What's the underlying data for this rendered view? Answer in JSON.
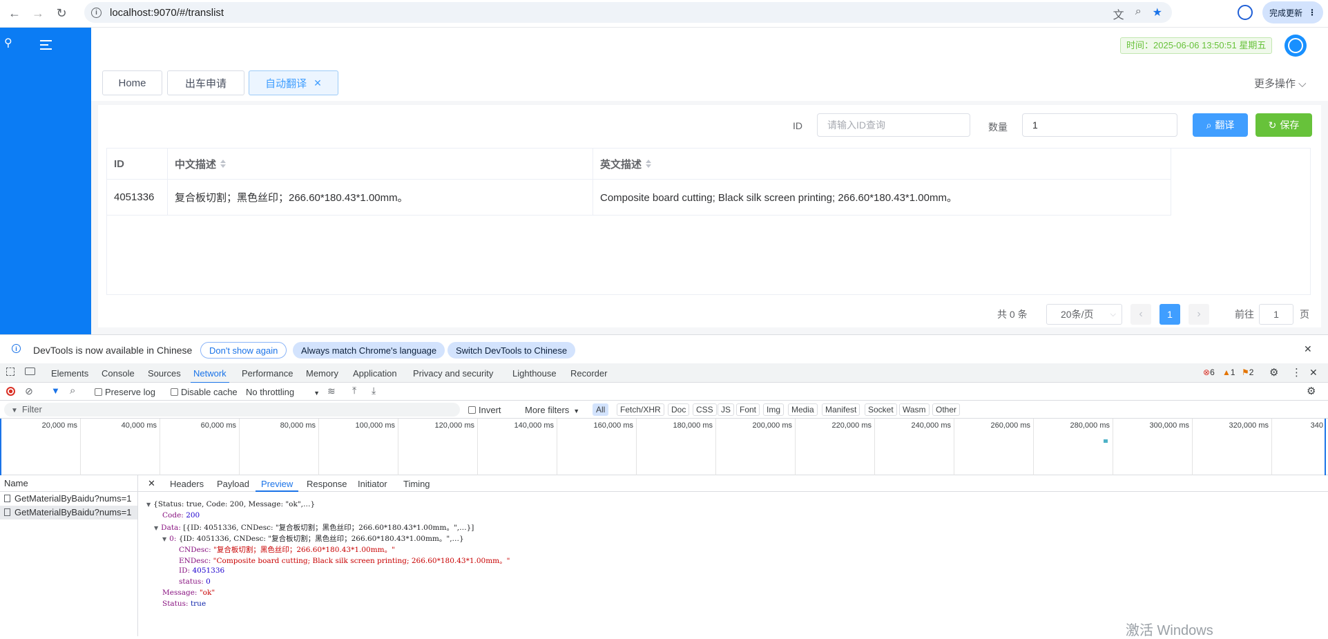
{
  "browser": {
    "url": "localhost:9070/#/translist",
    "update_button": "完成更新"
  },
  "header": {
    "time_badge": "时间：2025-06-06 13:50:51 星期五"
  },
  "tabs": [
    {
      "label": "Home"
    },
    {
      "label": "出车申请"
    },
    {
      "label": "自动翻译",
      "close": "✕"
    }
  ],
  "more_ops": "更多操作 ⌵",
  "search": {
    "id_label": "ID",
    "id_placeholder": "请输入ID查询",
    "qty_label": "数量",
    "qty_value": "1",
    "translate_btn": "翻译",
    "save_btn": "保存"
  },
  "table": {
    "columns": [
      "ID",
      "中文描述",
      "英文描述"
    ],
    "rows": [
      {
        "id": "4051336",
        "cn": "复合板切割；黑色丝印；266.60*180.43*1.00mm。",
        "en": "Composite board cutting; Black silk screen printing; 266.60*180.43*1.00mm。"
      }
    ]
  },
  "pagination": {
    "total": "共 0 条",
    "page_size": "20条/页",
    "current": "1",
    "goto_label": "前往",
    "goto_value": "1",
    "page_suffix": "页"
  },
  "devtools": {
    "info_text": "DevTools is now available in Chinese",
    "dont_show": "Don't show again",
    "always_match": "Always match Chrome's language",
    "switch": "Switch DevTools to Chinese",
    "tabs": [
      "Elements",
      "Console",
      "Sources",
      "Network",
      "Performance",
      "Memory",
      "Application",
      "Privacy and security",
      "Lighthouse",
      "Recorder"
    ],
    "errors": "6",
    "warnings": "1",
    "issues": "2",
    "preserve_log": "Preserve log",
    "disable_cache": "Disable cache",
    "throttling": "No throttling",
    "filter_placeholder": "Filter",
    "invert": "Invert",
    "more_filters": "More filters",
    "type_filters": [
      "All",
      "Fetch/XHR",
      "Doc",
      "CSS",
      "JS",
      "Font",
      "Img",
      "Media",
      "Manifest",
      "Socket",
      "Wasm",
      "Other"
    ],
    "timeline_ticks": [
      "20,000 ms",
      "40,000 ms",
      "60,000 ms",
      "80,000 ms",
      "100,000 ms",
      "120,000 ms",
      "140,000 ms",
      "160,000 ms",
      "180,000 ms",
      "200,000 ms",
      "220,000 ms",
      "240,000 ms",
      "260,000 ms",
      "280,000 ms",
      "300,000 ms",
      "320,000 ms",
      "340"
    ],
    "name_header": "Name",
    "requests": [
      "GetMaterialByBaidu?nums=1",
      "GetMaterialByBaidu?nums=1"
    ],
    "detail_tabs": [
      "Headers",
      "Payload",
      "Preview",
      "Response",
      "Initiator",
      "Timing"
    ],
    "preview": {
      "line1": "{Status: true, Code: 200, Message: \"ok\",…}",
      "code_key": "Code:",
      "code_val": "200",
      "data_key": "Data:",
      "data_val": "[{ID: 4051336, CNDesc: \"复合板切割；黑色丝印；266.60*180.43*1.00mm。\",…}]",
      "item_key": "0:",
      "item_val": "{ID: 4051336, CNDesc: \"复合板切割；黑色丝印；266.60*180.43*1.00mm。\",…}",
      "cndesc_key": "CNDesc:",
      "cndesc_val": "\"复合板切割；黑色丝印；266.60*180.43*1.00mm。\"",
      "endesc_key": "ENDesc:",
      "endesc_val": "\"Composite board cutting; Black silk screen printing; 266.60*180.43*1.00mm。\"",
      "id_key": "ID:",
      "id_val": "4051336",
      "status_key": "status:",
      "status_val": "0",
      "message_key": "Message:",
      "message_val": "\"ok\"",
      "status2_key": "Status:",
      "status2_val": "true"
    }
  },
  "watermark": "激活 Windows"
}
